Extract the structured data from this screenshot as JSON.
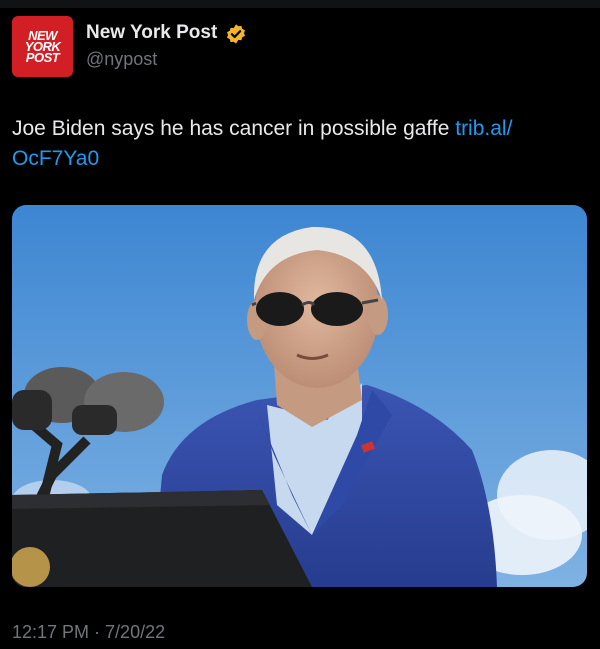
{
  "account": {
    "logo_text": "NEW\nYORK\nPOST",
    "name": "New York Post",
    "handle": "@nypost",
    "verified": true
  },
  "tweet": {
    "text": "Joe Biden says he has cancer in possible gaffe ",
    "link_text": "trib.al/\nOcF7Ya0",
    "timestamp": "12:17 PM · 7/20/22"
  },
  "colors": {
    "background": "#000000",
    "text": "#e7e9ea",
    "muted": "#71767b",
    "link": "#1d9bf0",
    "badge": "#f5b52b",
    "logo_red": "#d21f26"
  },
  "icons": {
    "verified_badge": "verified-gold-badge-icon"
  }
}
